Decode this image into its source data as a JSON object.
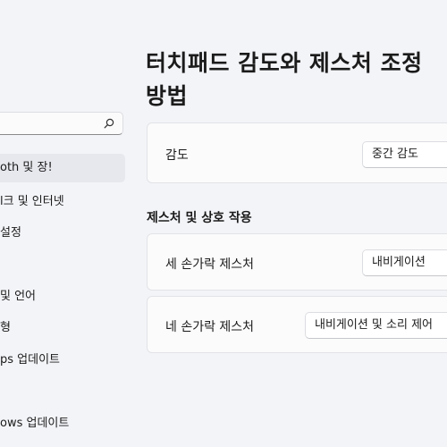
{
  "sidebar": {
    "search_placeholder": "",
    "items": [
      {
        "label": "oth 및 장!",
        "active": true
      },
      {
        "label": "l크 및 인터넷"
      },
      {
        "label": "설정"
      },
      {
        "label": "및 언어"
      },
      {
        "label": "형"
      },
      {
        "label": "ps 업데이트"
      },
      {
        "label": "ows 업데이트"
      }
    ]
  },
  "main": {
    "title_line1": "터치패드 감도와 제스처 조정",
    "title_line2": "방법",
    "sensitivity": {
      "label": "감도",
      "value": "중간 감도"
    },
    "section_title": "제스처 및 상호 작용",
    "three_finger": {
      "label": "세 손가락 제스처",
      "value": "내비게이션"
    },
    "four_finger": {
      "label": "네 손가락 제스처",
      "value": "내비게이션 및 소리 제어"
    }
  },
  "colors": {
    "background": "#f3f4f8",
    "card": "#fbfbfc",
    "active": "#e7e8ee"
  }
}
